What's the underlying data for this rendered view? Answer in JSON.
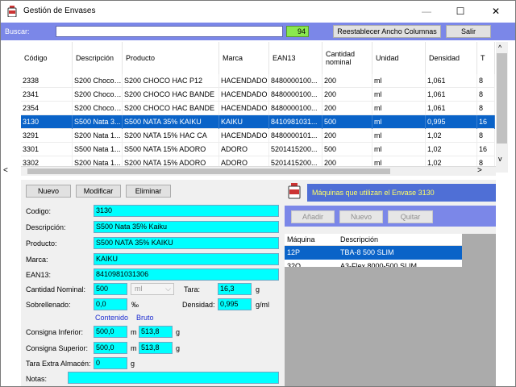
{
  "window": {
    "title": "Gestión de Envases",
    "minimize": "—",
    "maximize": "☐",
    "close": "✕"
  },
  "search": {
    "label": "Buscar:",
    "value": "",
    "count": "94",
    "reset_label": "Reestablecer Ancho Columnas",
    "exit_label": "Salir"
  },
  "grid": {
    "columns": [
      "Código",
      "Descripción",
      "Producto",
      "Marca",
      "EAN13",
      "Cantidad nominal",
      "Unidad",
      "Densidad",
      "T"
    ],
    "rows": [
      [
        "2338",
        "S200 Choco ...",
        "S200 CHOCO HAC P12",
        "HACENDADO",
        "8480000100...",
        "200",
        "ml",
        "1,061",
        "8"
      ],
      [
        "2341",
        "S200 Choco ...",
        "S200 CHOCO HAC BANDE",
        "HACENDADO",
        "8480000100...",
        "200",
        "ml",
        "1,061",
        "8"
      ],
      [
        "2354",
        "S200 Choco ...",
        "S200 CHOCO HAC BANDE",
        "HACENDADO",
        "8480000100...",
        "200",
        "ml",
        "1,061",
        "8"
      ],
      [
        "3130",
        "S500 Nata 3...",
        "S500 NATA 35% KAIKU",
        "KAIKU",
        "8410981031...",
        "500",
        "ml",
        "0,995",
        "16"
      ],
      [
        "3291",
        "S200 Nata 1...",
        "S200 NATA 15% HAC CA",
        "HACENDADO",
        "8480000101...",
        "200",
        "ml",
        "1,02",
        "8"
      ],
      [
        "3301",
        "S500 Nata 1...",
        "S500 NATA 15% ADORO",
        "ADORO",
        "5201415200...",
        "500",
        "ml",
        "1,02",
        "16"
      ],
      [
        "3302",
        "S200 Nata 1...",
        "S200 NATA 15% ADORO",
        "ADORO",
        "5201415200...",
        "200",
        "ml",
        "1,02",
        "8"
      ]
    ],
    "selected_row": 3
  },
  "form": {
    "new_label": "Nuevo",
    "modify_label": "Modificar",
    "delete_label": "Eliminar",
    "codigo_label": "Codigo:",
    "codigo": "3130",
    "descripcion_label": "Descripción:",
    "descripcion": "S500 Nata 35% Kaiku",
    "producto_label": "Producto:",
    "producto": "S500 NATA 35% KAIKU",
    "marca_label": "Marca:",
    "marca": "KAIKU",
    "ean13_label": "EAN13:",
    "ean13": "8410981031306",
    "cantidad_label": "Cantidad Nominal:",
    "cantidad": "500",
    "unidad": "ml",
    "tara_label": "Tara:",
    "tara": "16,3",
    "tara_unit": "g",
    "sobrellenado_label": "Sobrellenado:",
    "sobrellenado": "0,0",
    "sobrellenado_unit": "‰",
    "densidad_label": "Densidad:",
    "densidad": "0,995",
    "densidad_unit": "g/ml",
    "contenido_label": "Contenido",
    "bruto_label": "Bruto",
    "consigna_inf_label": "Consigna Inferior:",
    "consigna_inf": "500,0",
    "consigna_inf_unit": "m",
    "consigna_inf_bruto": "513,8",
    "consigna_inf_bruto_unit": "g",
    "consigna_sup_label": "Consigna Superior:",
    "consigna_sup": "500,0",
    "consigna_sup_unit": "m",
    "consigna_sup_bruto": "513,8",
    "consigna_sup_bruto_unit": "g",
    "tara_extra_label": "Tara Extra Almacén:",
    "tara_extra": "0",
    "tara_extra_unit": "g",
    "notas_label": "Notas:",
    "notas": ""
  },
  "machines": {
    "header": "Máquinas que utilizan el Envase 3130",
    "add_label": "Añadir",
    "new_label": "Nuevo",
    "remove_label": "Quitar",
    "columns": [
      "Máquina",
      "Descripción"
    ],
    "rows": [
      [
        "12P",
        "TBA-8 500 SLIM"
      ],
      [
        "32Q",
        "A3-Flex 8000-500  SLIM"
      ]
    ],
    "selected_row": 0
  },
  "colors": {
    "accent": "#7b87e8",
    "selection": "#0a63c8",
    "field": "#00ffff",
    "count": "#8ae84f"
  }
}
